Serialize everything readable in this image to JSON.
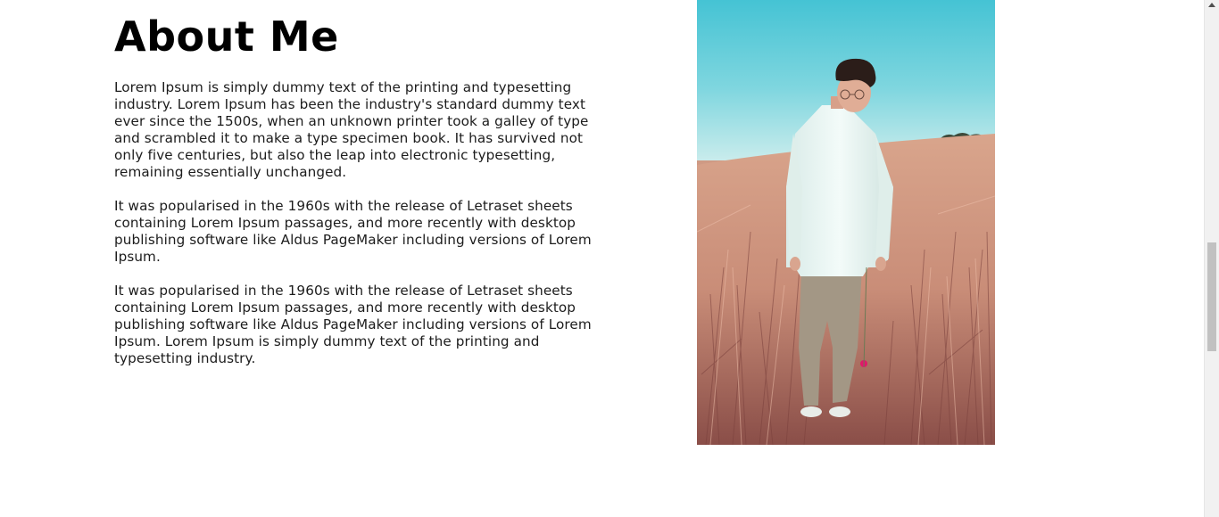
{
  "about": {
    "title": "About Me",
    "paragraphs": [
      "Lorem Ipsum is simply dummy text of the printing and typesetting industry. Lorem Ipsum has been the industry's standard dummy text ever since the 1500s, when an unknown printer took a galley of type and scrambled it to make a type specimen book. It has survived not only five centuries, but also the leap into electronic typesetting, remaining essentially unchanged.",
      "It was popularised in the 1960s with the release of Letraset sheets containing Lorem Ipsum passages, and more recently with desktop publishing software like Aldus PageMaker including versions of Lorem Ipsum.",
      "It was popularised in the 1960s with the release of Letraset sheets containing Lorem Ipsum passages, and more recently with desktop publishing software like Aldus PageMaker including versions of Lorem Ipsum. Lorem Ipsum is simply dummy text of the printing and typesetting industry."
    ]
  },
  "photo": {
    "subject": "young man in white shirt standing in tall dry grass field",
    "colors": {
      "sky": "#4cc6d6",
      "sky_light": "#bfe8ea",
      "grass": "#cf9a84",
      "grass_dark": "#6b3a36",
      "shirt": "#e6f1ef",
      "trousers": "#a09585",
      "hair": "#2a1c18",
      "flower": "#e0176a"
    }
  },
  "scrollbar": {
    "icon": "scroll-up-arrow-icon"
  }
}
